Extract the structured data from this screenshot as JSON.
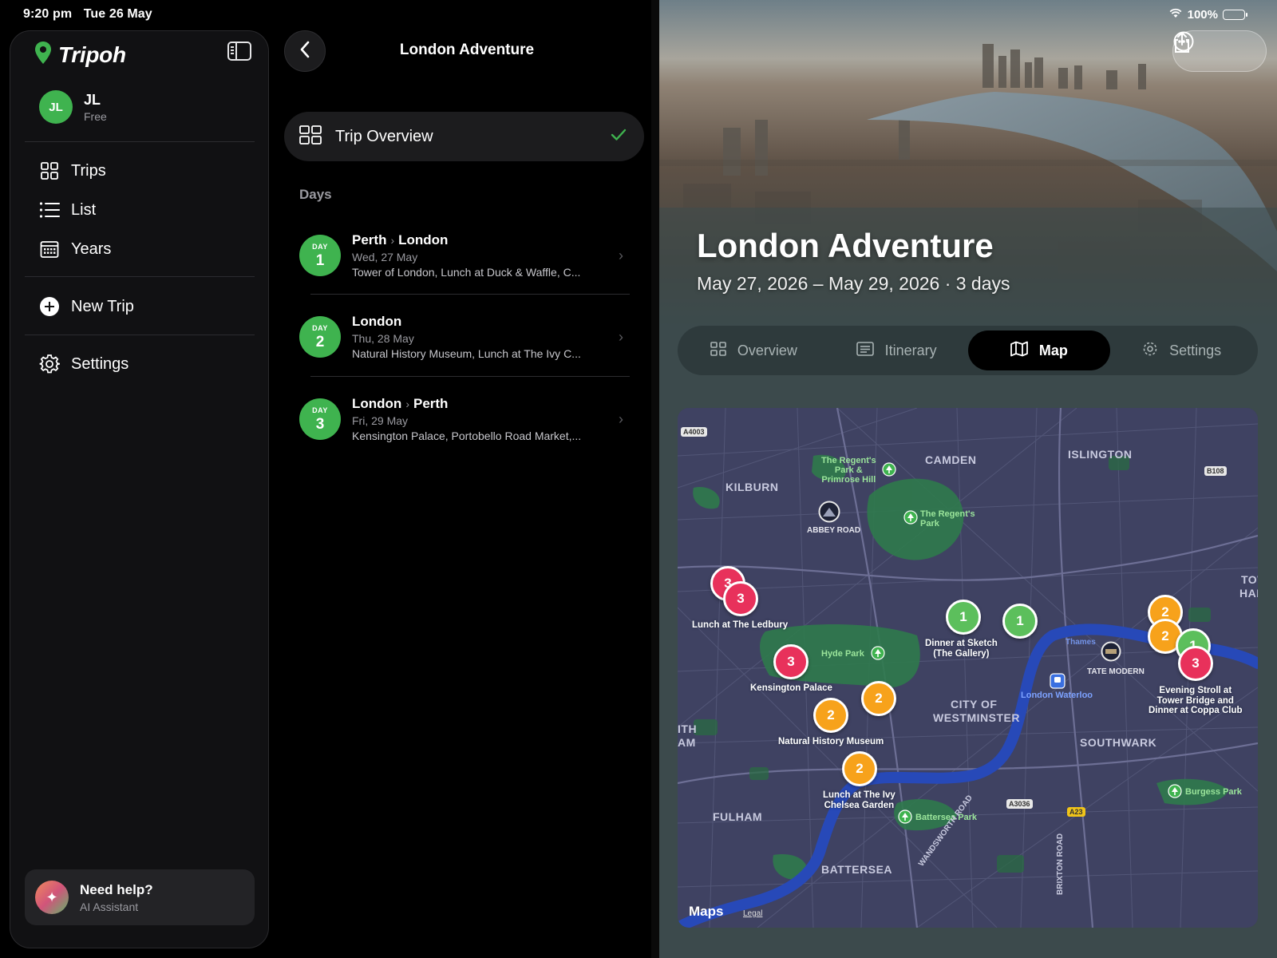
{
  "status": {
    "time": "9:20 pm",
    "date": "Tue 26 May",
    "battery": "100%"
  },
  "brand": {
    "name": "Tripoh"
  },
  "user": {
    "initials": "JL",
    "name": "JL",
    "plan": "Free"
  },
  "nav": {
    "trips": "Trips",
    "list": "List",
    "years": "Years",
    "new_trip": "New Trip",
    "settings": "Settings"
  },
  "help": {
    "title": "Need help?",
    "subtitle": "AI Assistant"
  },
  "middle": {
    "title": "London Adventure",
    "overview_label": "Trip Overview",
    "days_label": "Days",
    "days": [
      {
        "badge": "DAY",
        "num": "1",
        "from": "Perth",
        "to": "London",
        "date": "Wed, 27 May",
        "summary": "Tower of London, Lunch at Duck & Waffle, C..."
      },
      {
        "badge": "DAY",
        "num": "2",
        "from": "London",
        "to": "",
        "date": "Thu, 28 May",
        "summary": "Natural History Museum, Lunch at The Ivy C..."
      },
      {
        "badge": "DAY",
        "num": "3",
        "from": "London",
        "to": "Perth",
        "date": "Fri, 29 May",
        "summary": "Kensington Palace, Portobello Road Market,..."
      }
    ]
  },
  "hero": {
    "title": "London Adventure",
    "dates": "May 27, 2026 – May 29, 2026 · 3 days"
  },
  "tabs": {
    "overview": "Overview",
    "itinerary": "Itinerary",
    "map": "Map",
    "settings": "Settings",
    "active": "map"
  },
  "map": {
    "areas": {
      "camden": "CAMDEN",
      "islington": "ISLINGTON",
      "kilburn": "KILBURN",
      "city_of_westminster_1": "CITY OF",
      "city_of_westminster_2": "WESTMINSTER",
      "southwark": "SOUTHWARK",
      "fulham": "FULHAM",
      "battersea": "BATTERSEA",
      "tower_ham_1": "TOW",
      "tower_ham_2": "HAM",
      "ith": "ITH",
      "am": "AM"
    },
    "pois": {
      "regents_primrose": "The Regent's\nPark &\nPrimrose Hill",
      "regents_park": "The Regent's\nPark",
      "abbey_road": "ABBEY ROAD",
      "hyde_park": "Hyde Park",
      "tate_modern": "TATE MODERN",
      "london_waterloo": "London Waterloo",
      "battersea_park": "Battersea Park",
      "burgess_park": "Burgess Park",
      "thames": "Thames",
      "wandsworth_road": "WANDSWORTH ROAD",
      "brixton_road": "BRIXTON ROAD"
    },
    "roads": {
      "a4003": "A4003",
      "b108": "B108",
      "a3036": "A3036",
      "a23": "A23"
    },
    "pin_labels": {
      "ledbury": "Lunch at The Ledbury",
      "sketch": "Dinner at Sketch\n(The Gallery)",
      "kensington": "Kensington Palace",
      "nhm": "Natural History Museum",
      "ivy": "Lunch at The Ivy\nChelsea Garden",
      "tower_bridge": "Evening Stroll at\nTower Bridge and\nDinner at Coppa Club"
    },
    "pins": [
      {
        "day": "3",
        "color": "#e8315b"
      },
      {
        "day": "3",
        "color": "#e8315b"
      },
      {
        "day": "3",
        "color": "#e8315b"
      },
      {
        "day": "1",
        "color": "#5cbf5c"
      },
      {
        "day": "1",
        "color": "#5cbf5c"
      },
      {
        "day": "2",
        "color": "#f7a21b"
      },
      {
        "day": "2",
        "color": "#f7a21b"
      },
      {
        "day": "2",
        "color": "#f7a21b"
      },
      {
        "day": "2",
        "color": "#f7a21b"
      },
      {
        "day": "2",
        "color": "#f7a21b"
      },
      {
        "day": "1",
        "color": "#5cbf5c"
      },
      {
        "day": "3",
        "color": "#e8315b"
      }
    ],
    "attribution": "Maps",
    "legal": "Legal"
  },
  "colors": {
    "accent_green": "#3fb34f",
    "day1": "#5cbf5c",
    "day2": "#f7a21b",
    "day3": "#e8315b"
  }
}
